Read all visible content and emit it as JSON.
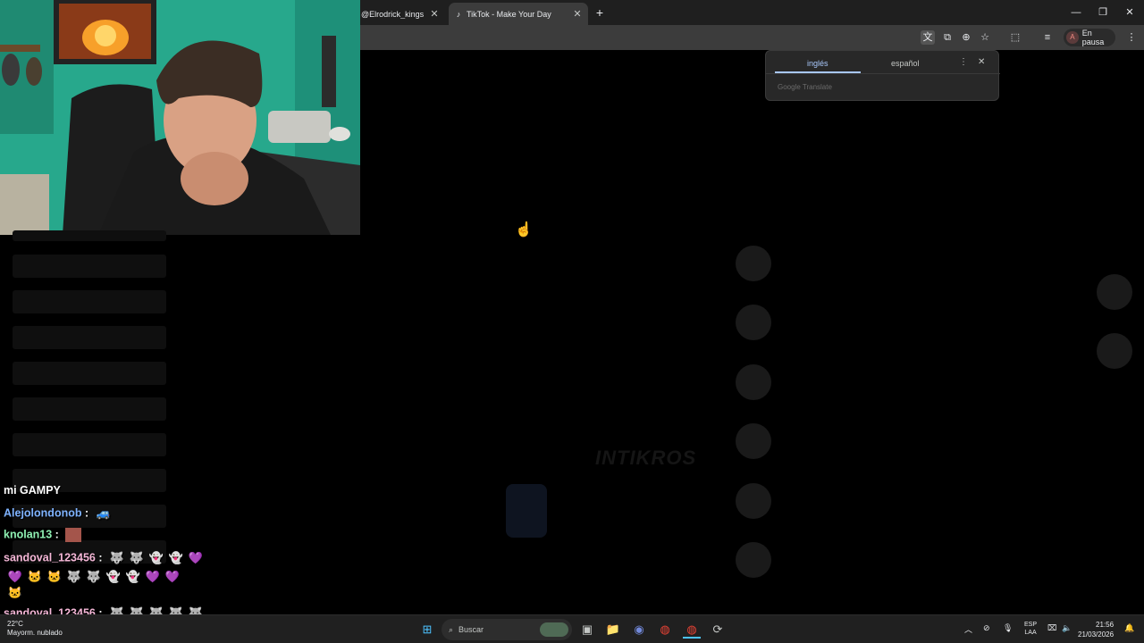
{
  "browser": {
    "tabs": [
      {
        "label": "@Elrodrick_kings",
        "favicon": "tiktok-icon"
      },
      {
        "label": "TikTok - Make Your Day",
        "favicon": "tiktok-icon"
      }
    ],
    "profile_status": "En pausa",
    "profile_initial": "A"
  },
  "translate_popup": {
    "source_lang": "inglés",
    "target_lang": "español",
    "brand": "Google Translate"
  },
  "video_watermark": "INTIKROS",
  "chat": [
    {
      "user": "mi GAMPY",
      "color": "#ffffff",
      "message": ""
    },
    {
      "user": "Alejolondonob",
      "color": "#7fb3ff",
      "message": ""
    },
    {
      "user": "knolan13",
      "color": "#8ef0b2",
      "message": ""
    },
    {
      "user": "sandoval_123456",
      "color": "#f5b7d7",
      "message": ""
    },
    {
      "user": "sandoval_123456",
      "color": "#f5b7d7",
      "message": ""
    }
  ],
  "taskbar": {
    "search_placeholder": "Buscar",
    "language": "ESP",
    "language_sub": "LAA",
    "time": "21:56",
    "date": "21/03/2026",
    "weather": "22°C",
    "weather_desc": "Mayorm. nublado"
  },
  "colors": {
    "tabstrip": "#1f1f1f",
    "toolbar": "#3c3c3c",
    "accent": "#a8c7fa",
    "taskbar": "#202020"
  }
}
